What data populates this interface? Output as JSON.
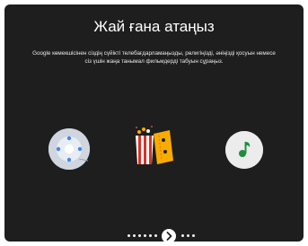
{
  "dialog": {
    "title": "Жай ғана атаңыз",
    "description": "Google көмекшісінен сіздің сүйікті телебағдарламаңызды, рөлигіңізді, әніңізді қосуын немесе сіз үшін жаңа танымал фильмдерді табуын сұраңыз."
  },
  "icons": {
    "left": "tv-remote-icon",
    "center": "popcorn-ticket-icon",
    "right": "music-note-icon"
  },
  "pager": {
    "total_dots": 9,
    "current_index": 5
  },
  "colors": {
    "background": "#1e1e1e",
    "text": "#ffffff",
    "popcorn_red": "#d93025",
    "ticket_yellow": "#f9ab00",
    "music_green": "#1e8e3e",
    "remote_blue": "#4285f4"
  }
}
